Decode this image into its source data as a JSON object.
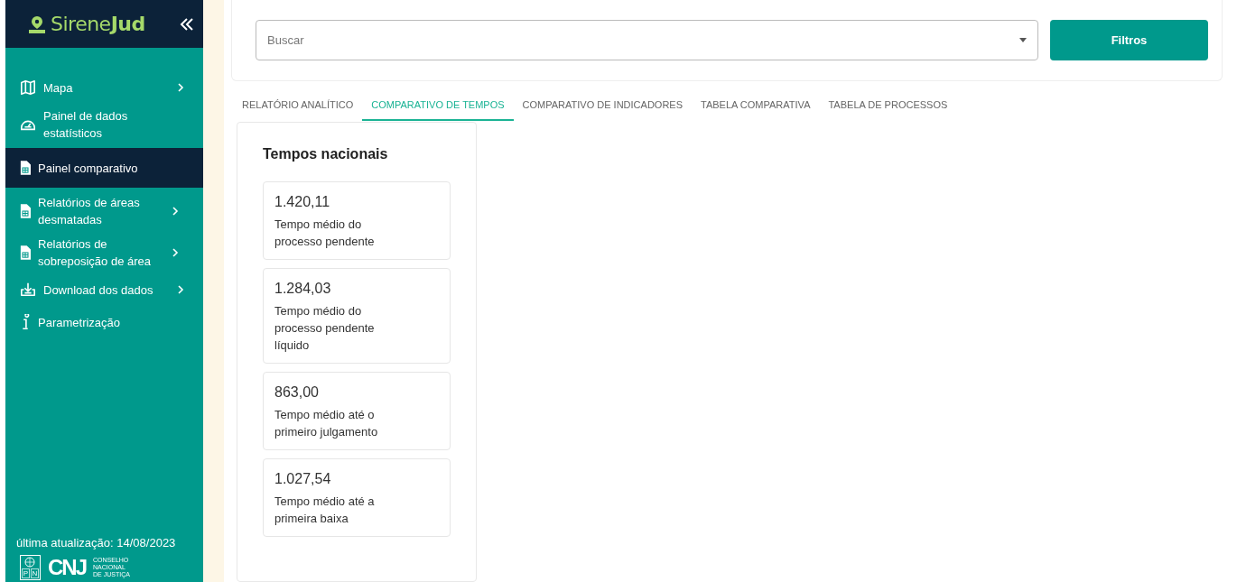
{
  "sidebar": {
    "logo": {
      "text_light": "Sirene",
      "text_bold": "Jud"
    },
    "items": [
      {
        "label": "Mapa",
        "expandable": true,
        "selected": false
      },
      {
        "label": "Painel de dados estatísticos",
        "expandable": false,
        "selected": false
      },
      {
        "label": "Painel comparativo",
        "expandable": false,
        "selected": true
      },
      {
        "label": "Relatórios de áreas desmatadas",
        "expandable": true,
        "selected": false
      },
      {
        "label": "Relatórios de sobreposição de área",
        "expandable": true,
        "selected": false
      },
      {
        "label": "Download dos dados",
        "expandable": true,
        "selected": false
      },
      {
        "label": "Parametrização",
        "expandable": false,
        "selected": false
      }
    ],
    "last_update": "última atualização: 14/08/2023",
    "footer": {
      "pnud_letters": [
        "P",
        "N"
      ],
      "cnj": "CNJ",
      "cnj_name": [
        "CONSELHO",
        "NACIONAL",
        "DE JUSTIÇA"
      ]
    }
  },
  "search": {
    "placeholder": "Buscar"
  },
  "filter_button": "Filtros",
  "tabs": [
    {
      "label": "RELATÓRIO ANALÍTICO",
      "selected": false
    },
    {
      "label": "COMPARATIVO DE TEMPOS",
      "selected": true
    },
    {
      "label": "COMPARATIVO DE INDICADORES",
      "selected": false
    },
    {
      "label": "TABELA COMPARATIVA",
      "selected": false
    },
    {
      "label": "TABELA DE PROCESSOS",
      "selected": false
    }
  ],
  "panel": {
    "title": "Tempos nacionais",
    "metrics": [
      {
        "value": "1.420,11",
        "label": "Tempo médio do processo pendente"
      },
      {
        "value": "1.284,03",
        "label": "Tempo médio do processo pendente líquido"
      },
      {
        "value": "863,00",
        "label": "Tempo médio até o primeiro julgamento"
      },
      {
        "value": "1.027,54",
        "label": "Tempo médio até a primeira baixa"
      }
    ]
  }
}
